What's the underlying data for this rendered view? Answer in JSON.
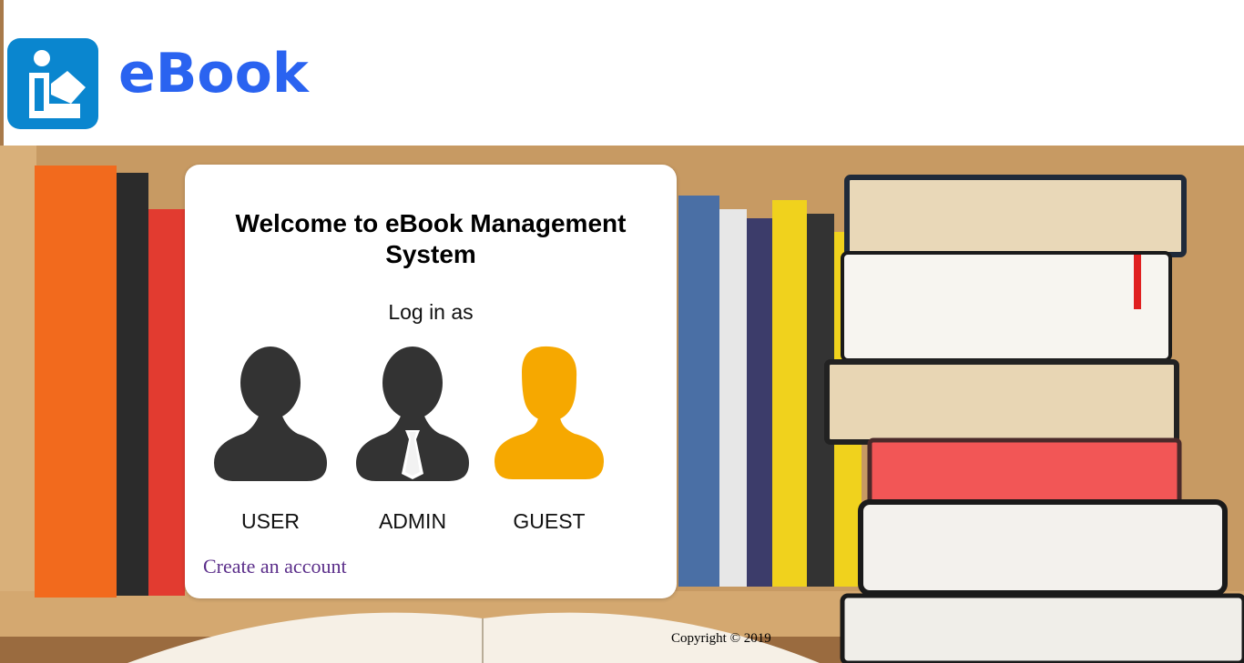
{
  "header": {
    "brand": "eBook",
    "logo_icon": "reading-person-icon",
    "logo_color": "#0a86cf",
    "brand_color": "#2a63f0"
  },
  "login": {
    "title": "Welcome to eBook Management System",
    "subtitle": "Log in as",
    "roles": [
      {
        "label": "USER",
        "icon": "user-silhouette-icon",
        "color": "#333333"
      },
      {
        "label": "ADMIN",
        "icon": "admin-silhouette-icon",
        "color": "#333333"
      },
      {
        "label": "GUEST",
        "icon": "guest-silhouette-icon",
        "color": "#f6a800"
      }
    ],
    "create_account": "Create an account"
  },
  "footer": {
    "copyright": "Copyright © 2019"
  }
}
